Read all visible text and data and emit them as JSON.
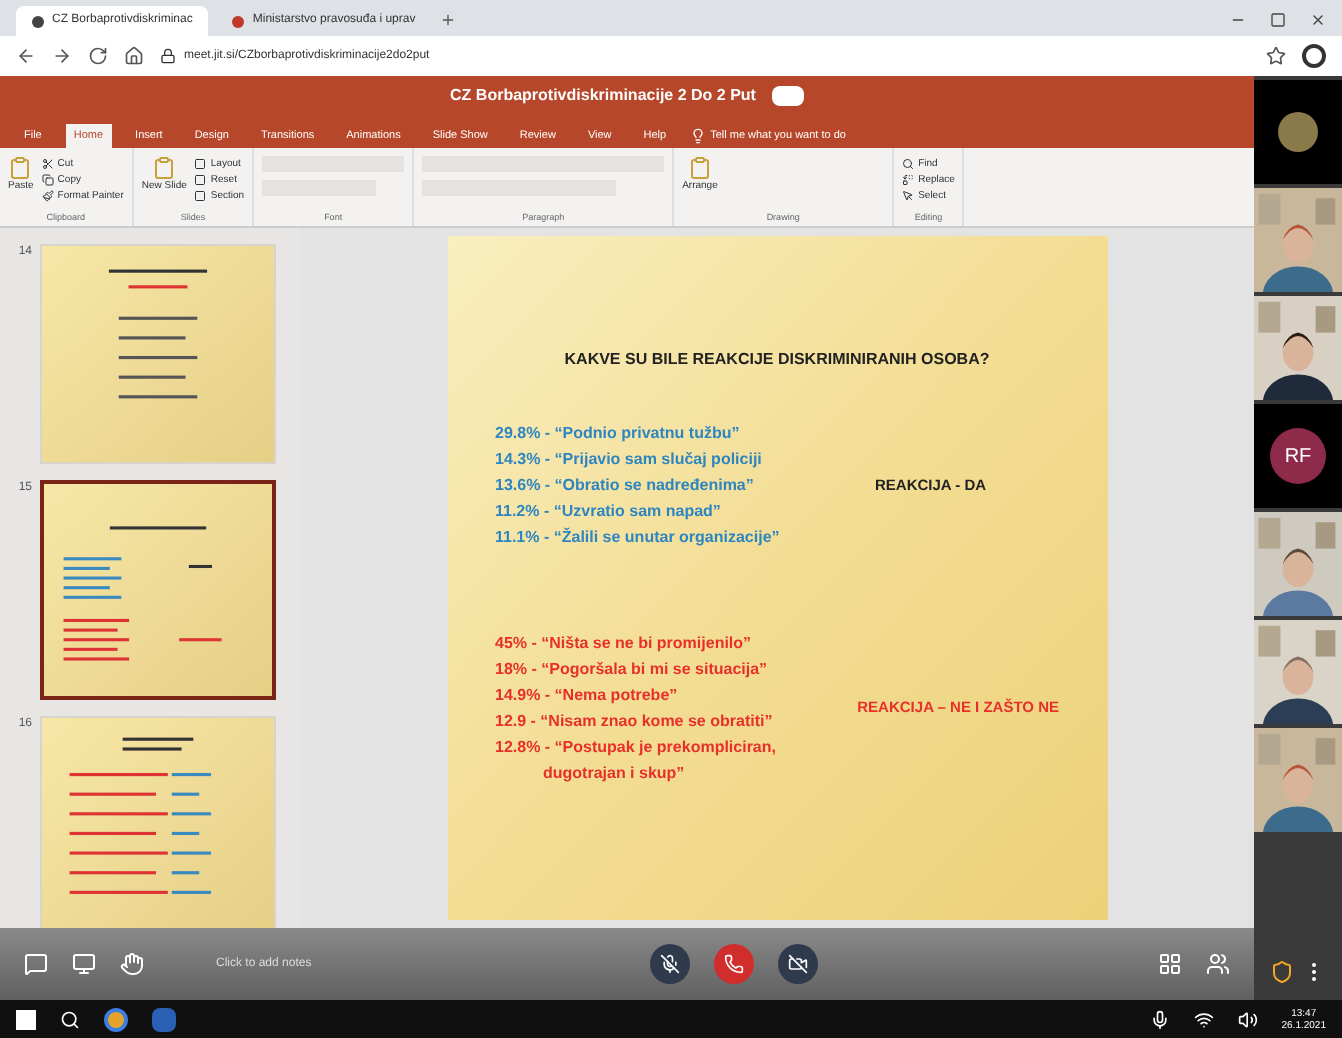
{
  "browser": {
    "tabs": [
      {
        "title": "CZ Borbaprotivdiskriminac",
        "selected": true
      },
      {
        "title": "Ministarstvo pravosuđa i uprav",
        "selected": false
      }
    ],
    "address": "meet.jit.si/CZborbaprotivdiskriminacije2do2put"
  },
  "powerpoint": {
    "title": "CZ Borbaprotivdiskriminacije 2 Do 2 Put",
    "ribbon_tabs": [
      {
        "label": "File",
        "selected": false
      },
      {
        "label": "Home",
        "selected": true
      },
      {
        "label": "Insert",
        "selected": false
      },
      {
        "label": "Design",
        "selected": false
      },
      {
        "label": "Transitions",
        "selected": false
      },
      {
        "label": "Animations",
        "selected": false
      },
      {
        "label": "Slide Show",
        "selected": false
      },
      {
        "label": "Review",
        "selected": false
      },
      {
        "label": "View",
        "selected": false
      },
      {
        "label": "Help",
        "selected": false
      }
    ],
    "tell_me": "Tell me what you want to do",
    "groups": [
      {
        "label": "Clipboard",
        "items": [
          "Cut",
          "Copy",
          "Format Painter"
        ],
        "big": "Paste"
      },
      {
        "label": "Slides",
        "items": [
          "Layout",
          "Reset",
          "Section"
        ],
        "big": "New Slide"
      },
      {
        "label": "Font"
      },
      {
        "label": "Paragraph"
      },
      {
        "label": "Drawing",
        "big": "Arrange"
      },
      {
        "label": "Editing",
        "items": [
          "Find",
          "Replace",
          "Select"
        ]
      }
    ],
    "thumbnails": [
      {
        "number": "14",
        "selected": false,
        "kind": "centered"
      },
      {
        "number": "15",
        "selected": true,
        "kind": "lists"
      },
      {
        "number": "16",
        "selected": false,
        "kind": "bullets"
      }
    ],
    "slide": {
      "title": "KAKVE SU BILE REAKCIJE DISKRIMINIRANIH OSOBA?",
      "groups": [
        {
          "label": "REAKCIJA - DA",
          "color": "#2e86c1",
          "items": [
            "29.8% - “Podnio privatnu tužbu”",
            "14.3% - “Prijavio sam slučaj policiji",
            "13.6% - “Obratio se nadređenima”",
            "11.2% - “Uzvratio sam napad”",
            "11.1% - “Žalili se unutar organizacije”"
          ]
        },
        {
          "label": "REAKCIJA – NE I ZAŠTO NE",
          "color": "#e8302a",
          "items": [
            "45% - “Ništa se ne bi promijenilo”",
            "18% - “Pogoršala bi mi se situacija”",
            "14.9% - “Nema potrebe”",
            "12.9 - “Nisam znao kome se obratiti”",
            "12.8% - “Postupak je prekompliciran, dugotrajan i skup”"
          ]
        }
      ]
    },
    "notes_placeholder": "Click to add notes"
  },
  "participants": [
    {
      "kind": "avatar_logo"
    },
    {
      "kind": "video"
    },
    {
      "kind": "video"
    },
    {
      "kind": "initials",
      "initials": "RF"
    },
    {
      "kind": "video"
    },
    {
      "kind": "video"
    },
    {
      "kind": "video"
    }
  ],
  "taskbar": {
    "time": "13:47",
    "date": "26.1.2021"
  }
}
